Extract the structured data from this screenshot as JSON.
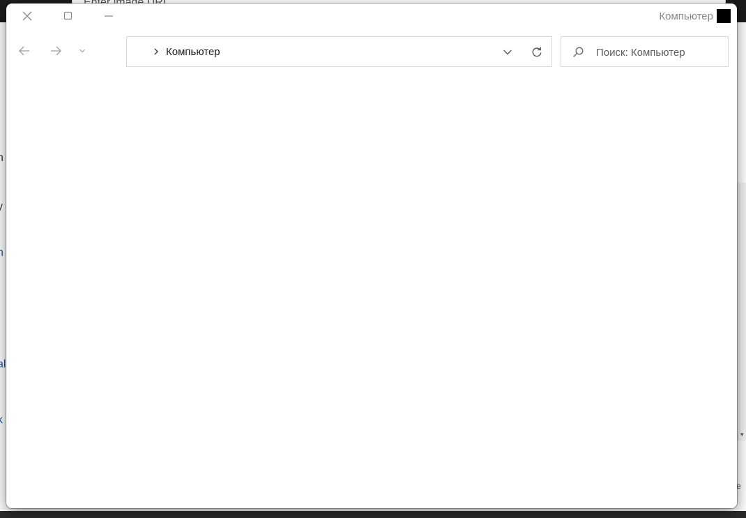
{
  "background": {
    "url_placeholder": "Enter image URL",
    "fragments": [
      "h",
      "y",
      "n",
      "'",
      "al",
      "k"
    ],
    "right_arrow": "▾",
    "right_letter": "e"
  },
  "dialog": {
    "title": "Компьютер",
    "breadcrumb": {
      "items": [
        {
          "label": "Компьютер"
        }
      ]
    },
    "search": {
      "placeholder": "Поиск: Компьютер",
      "value": ""
    },
    "icons": {
      "close": "close-icon",
      "maximize": "maximize-icon",
      "minimize": "minimize-icon",
      "back": "arrow-left-icon",
      "forward": "arrow-right-icon",
      "recent": "chevron-down-icon",
      "breadcrumb_separator": "chevron-right-icon",
      "address_dropdown": "chevron-down-icon",
      "refresh": "refresh-icon",
      "search": "search-icon"
    },
    "colors": {
      "title_text": "#8a8a8a",
      "border": "#d9d9d9",
      "icon_disabled": "#a0a0a0",
      "icon_active": "#555555"
    }
  }
}
